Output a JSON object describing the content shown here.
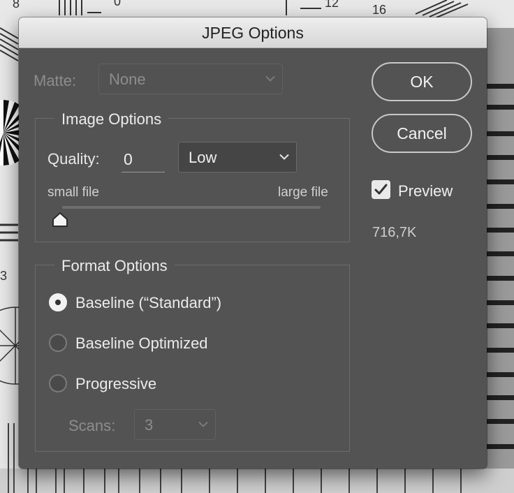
{
  "dialog": {
    "title": "JPEG Options"
  },
  "matte": {
    "label": "Matte:",
    "value": "None"
  },
  "image_options": {
    "title": "Image Options",
    "quality_label": "Quality:",
    "quality_value": "0",
    "quality_preset": "Low",
    "slider_min_label": "small file",
    "slider_max_label": "large file",
    "slider_level": 0
  },
  "format_options": {
    "title": "Format Options",
    "choices": [
      {
        "label": "Baseline (“Standard”)",
        "selected": true
      },
      {
        "label": "Baseline Optimized",
        "selected": false
      },
      {
        "label": "Progressive",
        "selected": false
      }
    ],
    "scans_label": "Scans:",
    "scans_value": "3"
  },
  "buttons": {
    "ok": "OK",
    "cancel": "Cancel"
  },
  "preview": {
    "label": "Preview",
    "checked": true,
    "file_size": "716,7K"
  },
  "background": {
    "visible_numbers": [
      "8",
      "0",
      "12",
      "16",
      "3"
    ]
  },
  "colors": {
    "dialog_bg": "#535353",
    "titlebar": "#e2e2e2",
    "text": "#e6e6e6",
    "disabled_text": "#8d8d8d"
  }
}
